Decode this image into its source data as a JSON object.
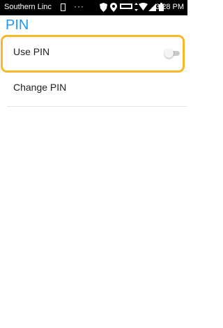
{
  "status_bar": {
    "carrier": "Southern Linc",
    "dots": "···",
    "time": "3:28 PM",
    "icons": [
      "sim-icon",
      "shield-icon",
      "location-icon",
      "volte-icon",
      "wifi-icon",
      "signal-icon",
      "battery-icon"
    ]
  },
  "header": {
    "title": "PIN"
  },
  "settings": {
    "use_pin_label": "Use PIN",
    "use_pin_enabled": false,
    "change_pin_label": "Change PIN"
  },
  "colors": {
    "accent": "#2196f3",
    "highlight": "#f7b827",
    "status_bar_bg": "#000000"
  }
}
